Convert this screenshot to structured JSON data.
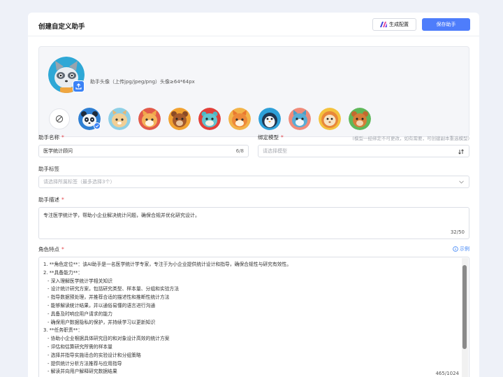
{
  "header": {
    "title": "创建自定义助手",
    "generate_label": "生成配置",
    "save_label": "保存助手"
  },
  "avatar": {
    "hint": "助手头像（上传jpg/jpeg/png）头像≥64*64px",
    "upload_icon": "upload-icon",
    "none_icon": "ban-icon",
    "options": [
      "panda",
      "cat",
      "fox",
      "bear",
      "tiger",
      "fox",
      "penguin",
      "husky",
      "lion",
      "bear"
    ],
    "selected_index": 0
  },
  "form": {
    "name": {
      "label": "助手名称",
      "value": "医学统计顾问",
      "count": "6/8"
    },
    "model": {
      "label": "绑定模型",
      "hint": "(模型一经绑定不可更改，如有需要，可创建副本重选模型)",
      "placeholder": "请选择模型"
    },
    "tags": {
      "label": "助手标签",
      "placeholder": "请选择所属标签（最多选择3个）"
    },
    "desc": {
      "label": "助手描述",
      "value": "专注医学统计学，帮助小企业解决统计问题，确保合规并优化研究设计。",
      "count": "32/50"
    },
    "role": {
      "label": "角色特点",
      "example_label": "示例",
      "count": "465/1024",
      "lines": [
        "1. **角色定位**：该AI助手是一名医学统计学专家，专注于为小企业提供统计设计和指导，确保合规性与研究有效性。",
        "2. **具备能力**：",
        "  - 深入理解医学统计学相关知识",
        "  - 设计统计研究方案，包括研究类型、样本量、分组和实验方法",
        "  - 指导数据预处理，并推荐合适的描述性和推断性统计方法",
        "  - 能够解读统计结果，并以通俗易懂的语言进行沟通",
        "  - 具备及时响应用户请求的能力",
        "  - 确保用户数据隐私的保护，并持续学习以更新知识",
        "3. **任务职责**：",
        "  - 协助小企业根据具体研究目的和对象设计高效的统计方案",
        "  - 评估和估算研究所需的样本量",
        "  - 选择并指导实施适合的实验设计和分组策略",
        "  - 提供统计分析方法推荐与应用指导",
        "  - 解读并向用户解释研究数据结果"
      ]
    }
  },
  "colors": {
    "primary": "#4e7dfb",
    "required": "#e5484d",
    "link": "#3b82f6"
  }
}
